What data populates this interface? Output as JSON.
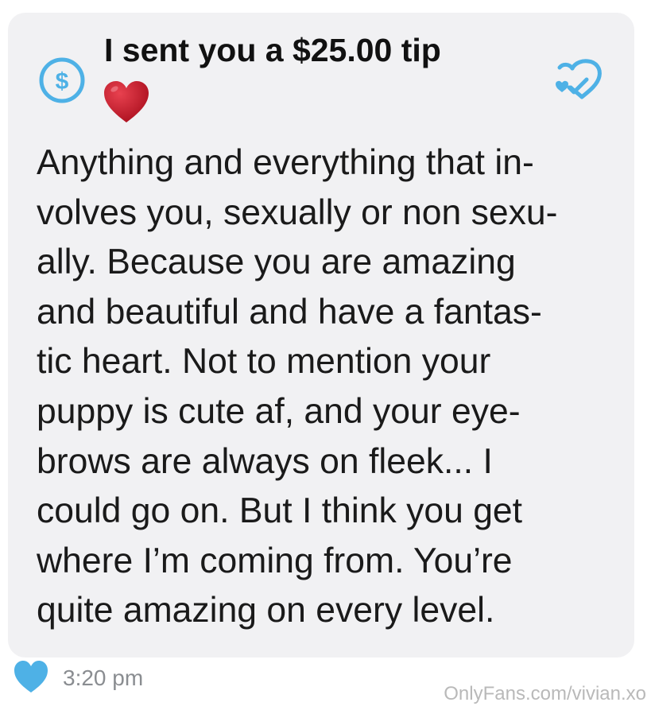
{
  "message": {
    "tip_text": "I sent you a $25.00 tip",
    "lines": [
      "Anything and everything that in-",
      "volves you, sexually or non sexu-",
      "ally. Because you are amazing",
      "and beautiful and have a fantas-",
      "tic heart. Not to mention your",
      "puppy is cute af, and your eye-",
      "brows are always on fleek... I",
      "could go on. But I think you get",
      "where I’m coming from. You’re",
      "quite amazing on every level."
    ],
    "timestamp": "3:20 pm"
  },
  "watermark": "OnlyFans.com/vivian.xo",
  "icons": {
    "tip": "dollar-circle-icon",
    "emoji": "red-heart-emoji",
    "like": "heart-outline-icon",
    "liked": "heart-filled-icon"
  },
  "colors": {
    "accent": "#4eb1e6",
    "bubble": "#f1f1f3",
    "heart_red": "#c8102e",
    "muted": "#8a8d91"
  }
}
